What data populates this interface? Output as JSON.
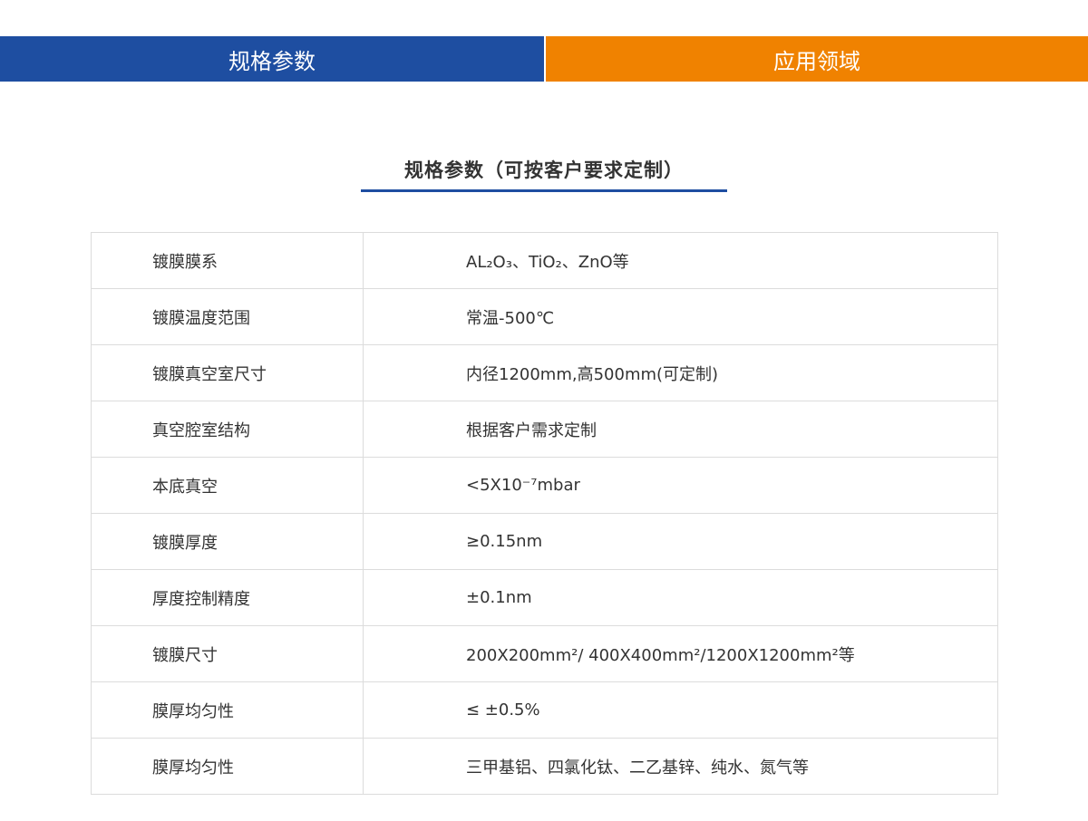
{
  "tabs": {
    "specs_label": "规格参数",
    "apps_label": "应用领域",
    "specs_color": "#1e4ea1",
    "apps_color": "#f08200"
  },
  "section": {
    "title": "规格参数（可按客户要求定制）"
  },
  "table": {
    "rows": [
      {
        "label": "镀膜膜系",
        "value": "AL₂O₃、TiO₂、ZnO等"
      },
      {
        "label": "镀膜温度范围",
        "value": "常温-500℃"
      },
      {
        "label": "镀膜真空室尺寸",
        "value": "内径1200mm,高500mm(可定制)"
      },
      {
        "label": "真空腔室结构",
        "value": "根据客户需求定制"
      },
      {
        "label": "本底真空",
        "value": "<5X10⁻⁷mbar"
      },
      {
        "label": "镀膜厚度",
        "value": "≥0.15nm"
      },
      {
        "label": "厚度控制精度",
        "value": "±0.1nm"
      },
      {
        "label": "镀膜尺寸",
        "value": "200X200mm²/ 400X400mm²/1200X1200mm²等"
      },
      {
        "label": "膜厚均匀性",
        "value": "≤ ±0.5%"
      },
      {
        "label": "膜厚均匀性",
        "value": "三甲基铝、四氯化钛、二乙基锌、纯水、氮气等"
      }
    ]
  }
}
